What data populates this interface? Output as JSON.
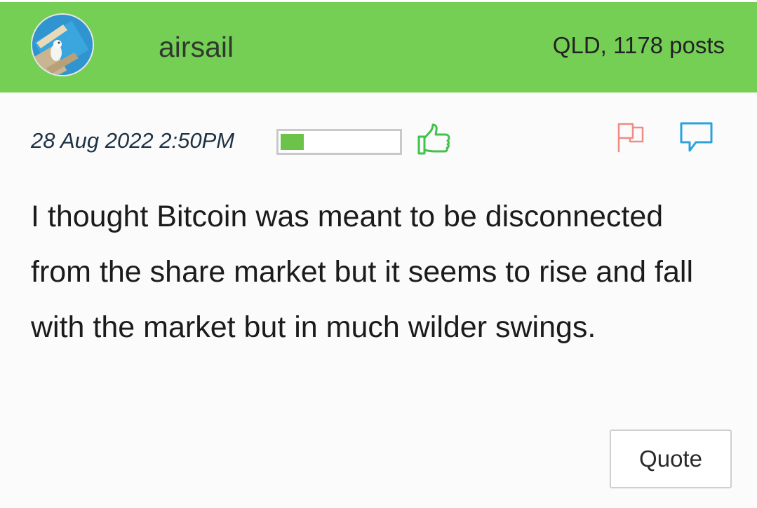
{
  "post": {
    "author": {
      "username": "airsail",
      "location_posts": "QLD, 1178 posts",
      "avatar_icon": "avatar-dog-pool"
    },
    "timestamp": "28 Aug 2022 2:50PM",
    "rating_fraction": 0.2,
    "icons": {
      "like": "thumbs-up-icon",
      "report": "flag-icon",
      "reply": "speech-bubble-icon"
    },
    "body": "I thought Bitcoin was meant to be disconnected from the share market but it seems to rise and fall with the market but in much wilder swings.",
    "quote_label": "Quote"
  },
  "colors": {
    "header_bg": "#76cf55",
    "rating_fill": "#6cc34c",
    "like_icon": "#41c24a",
    "flag_icon": "#ee8c86",
    "reply_icon": "#2aa3dc"
  }
}
